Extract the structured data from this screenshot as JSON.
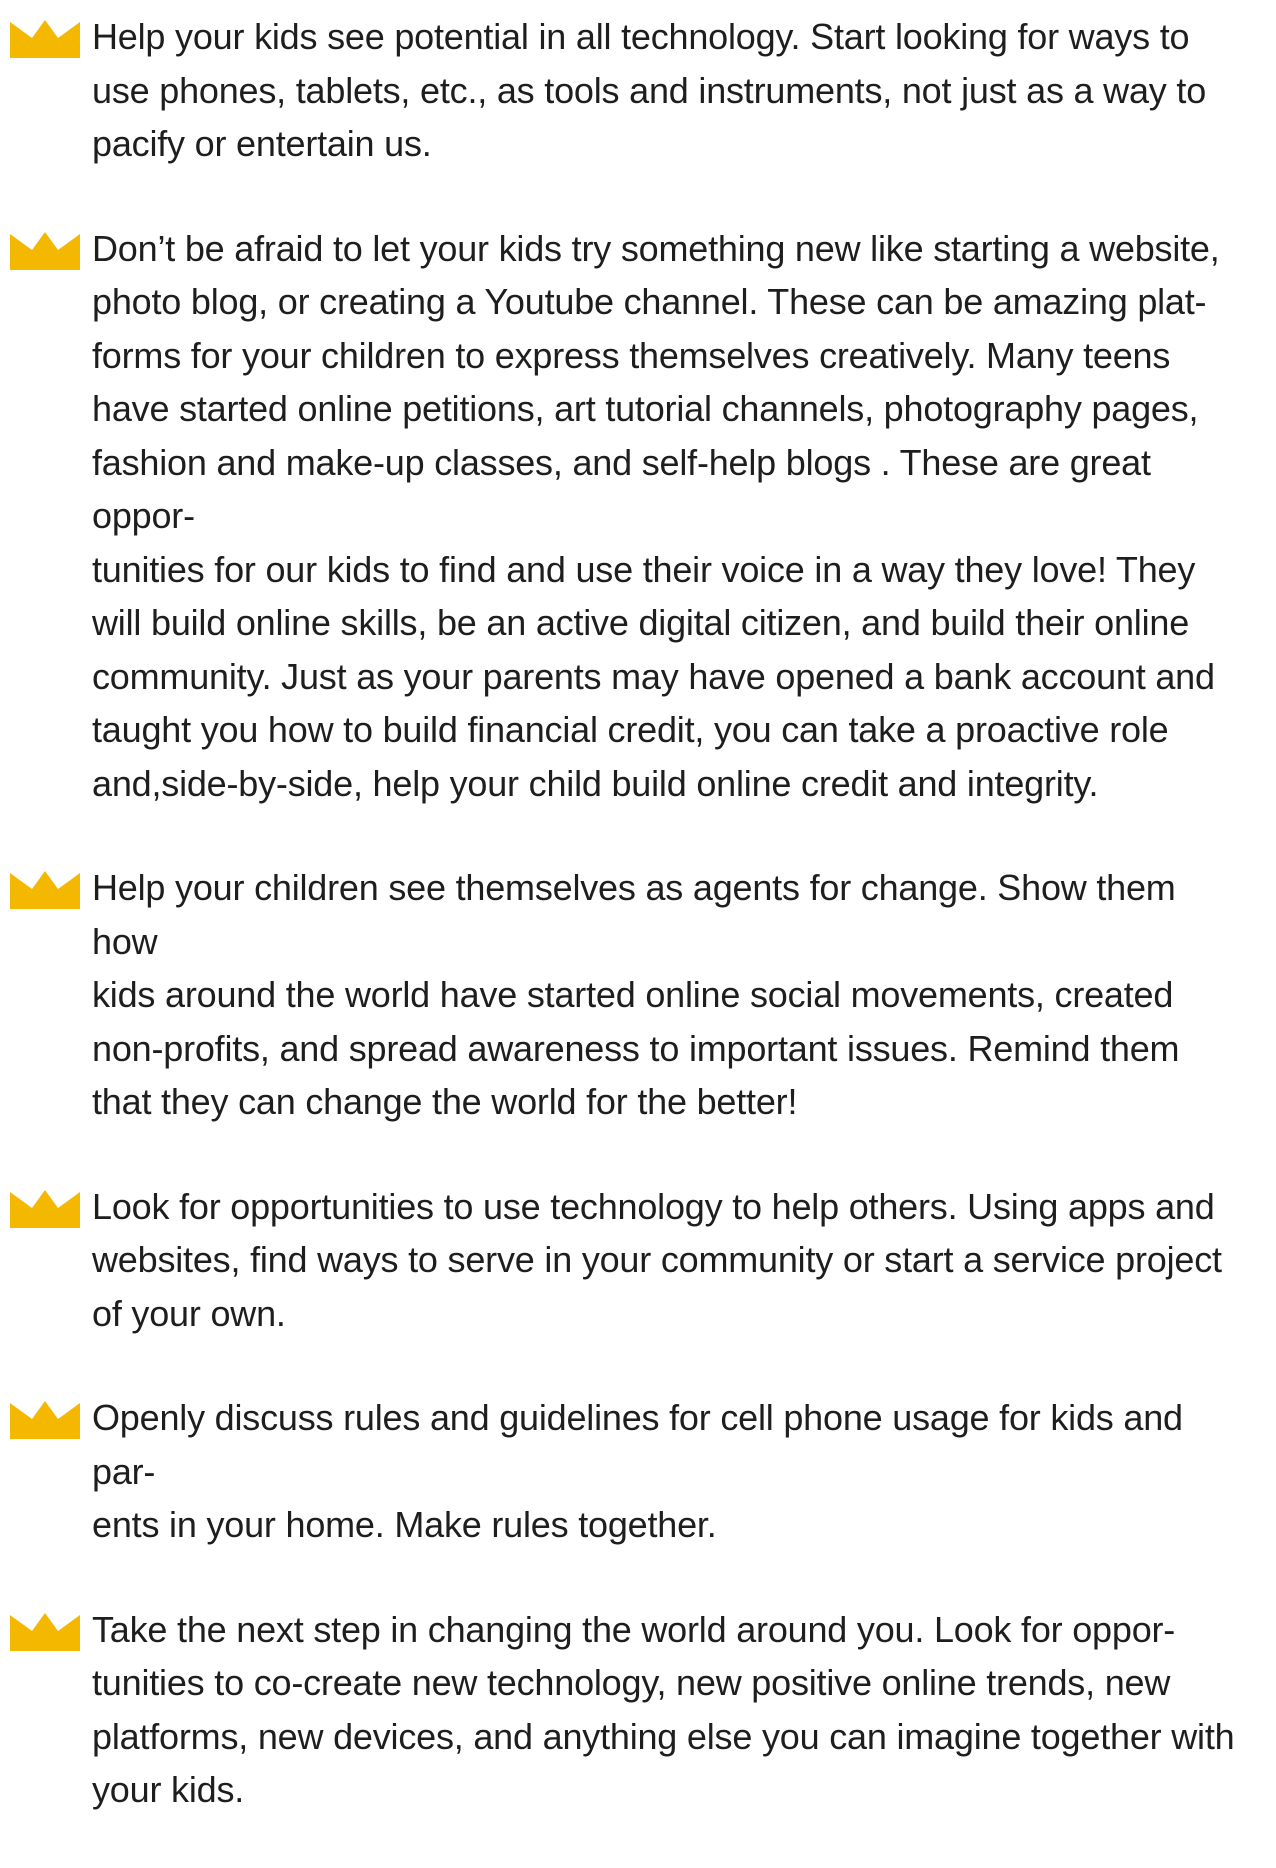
{
  "accent_color": "#F5B800",
  "bullet_icon": "crown-icon",
  "tips": [
    {
      "lines": [
        "Help your kids see potential in all technology. Start looking for ways to",
        "use phones, tablets, etc., as tools and instruments, not just as a way to",
        "pacify or entertain us."
      ]
    },
    {
      "lines": [
        "Don’t be afraid to let your kids try something new like starting a website,",
        "photo blog, or creating a Youtube channel. These can be amazing plat-",
        "forms for your children to express themselves creatively. Many teens",
        "have started online petitions, art tutorial channels, photography pages,",
        "fashion and make-up classes, and self-help blogs . These are great oppor-",
        "tunities for our kids to find and use their voice in a way they love! They",
        "will build online skills, be an active digital citizen, and build their online",
        "community. Just as your parents may have opened a bank account and",
        "taught you how to build financial credit, you can take a proactive role",
        "and,side-by-side, help your child build online credit and integrity."
      ]
    },
    {
      "lines": [
        "Help your children see themselves as agents for change. Show them how",
        "kids around the world have started online social movements, created",
        "non-profits, and spread awareness to important issues.  Remind them",
        "that they can change the world for the better!"
      ]
    },
    {
      "lines": [
        "Look for opportunities to use technology to help others. Using apps and",
        "websites, find ways to serve in your community or start a service project",
        "of your own."
      ]
    },
    {
      "lines": [
        "Openly discuss rules and guidelines for cell phone usage for kids and par-",
        "ents in your home. Make rules together."
      ]
    },
    {
      "lines": [
        "Take the next step in changing the world around you. Look for oppor-",
        "tunities to co-create new technology, new positive online trends, new",
        "platforms, new devices, and anything else you can imagine together with",
        "your kids."
      ]
    }
  ]
}
